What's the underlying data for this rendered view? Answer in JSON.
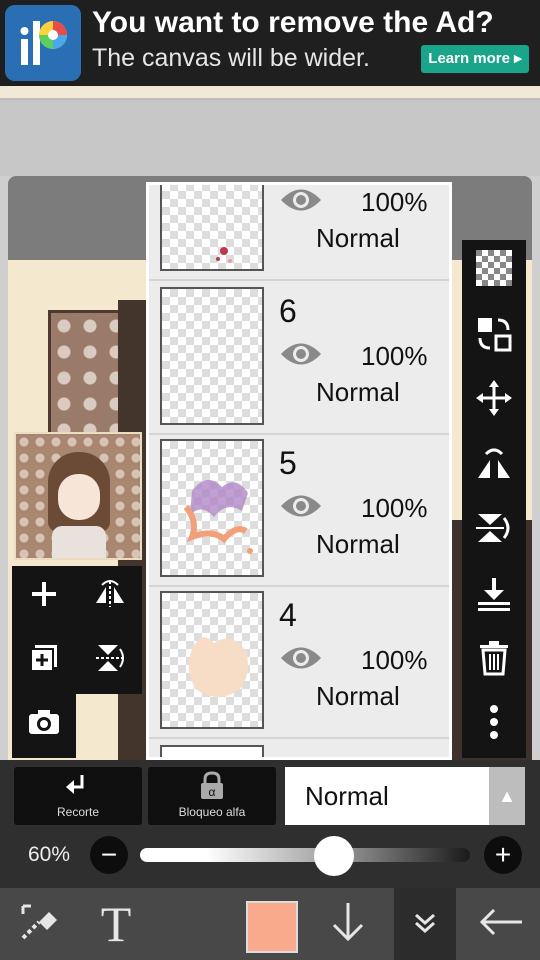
{
  "ad": {
    "title": "You want to remove the Ad?",
    "subtitle": "The canvas will be wider.",
    "learn_more": "Learn more ▸"
  },
  "layers": [
    {
      "number": "",
      "opacity": "100%",
      "mode": "Normal"
    },
    {
      "number": "6",
      "opacity": "100%",
      "mode": "Normal"
    },
    {
      "number": "5",
      "opacity": "100%",
      "mode": "Normal"
    },
    {
      "number": "4",
      "opacity": "100%",
      "mode": "Normal"
    }
  ],
  "bottom_buttons": {
    "recorte": "Recorte",
    "bloqueo": "Bloqueo alfa"
  },
  "blend_mode": "Normal",
  "opacity": {
    "label": "60%",
    "value": 0.6
  },
  "colors": {
    "current_color": "#f9a98c",
    "ad_button": "#1aa58a"
  },
  "icons": {
    "left_tools": [
      "plus-icon",
      "flip-horizontal-icon",
      "add-layer-icon",
      "flip-vertical-icon",
      "camera-icon"
    ],
    "right_tools": [
      "transparency-icon",
      "copy-swap-icon",
      "move-icon",
      "rotate-flip-icon",
      "flip-vertical-icon",
      "merge-down-icon",
      "trash-icon",
      "more-vertical-icon"
    ],
    "bottom_bar": [
      "eraser-selection-icon",
      "text-icon",
      "color-swatch",
      "arrow-down-icon",
      "chevron-double-down-icon",
      "back-arrow-icon"
    ]
  }
}
